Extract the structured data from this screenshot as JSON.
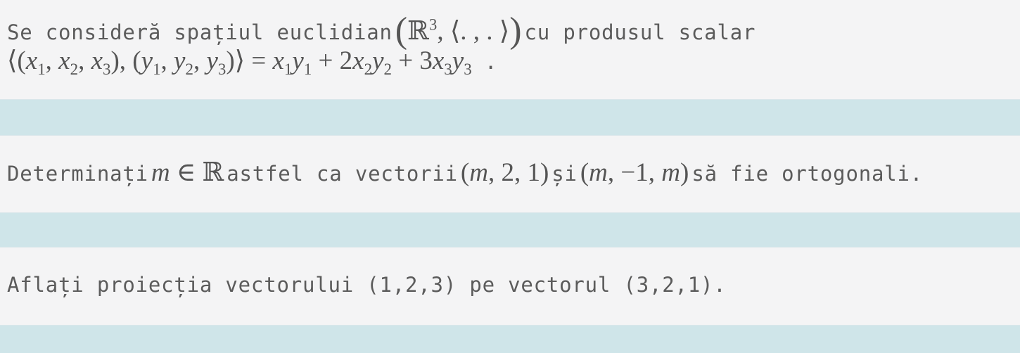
{
  "problem1": {
    "intro": "Se consideră spațiul euclidian",
    "space_open": "(",
    "space_R": "ℝ",
    "space_exp": "3",
    "space_rest": ", ⟨. , . ⟩",
    "space_close": ")",
    "tail": "cu produsul scalar",
    "eq": {
      "lhs_open": "⟨(",
      "x1": "x",
      "s1": "1",
      "x2": "x",
      "s2": "2",
      "x3": "x",
      "s3": "3",
      "mid": "), (",
      "y1": "y",
      "t1": "1",
      "y2": "y",
      "t2": "2",
      "y3": "y",
      "t3": "3",
      "lhs_close": ")⟩ = ",
      "r1x": "x",
      "r1s": "1",
      "r1y": "y",
      "r1t": "1",
      "plus1": " + 2",
      "r2x": "x",
      "r2s": "2",
      "r2y": "y",
      "r2t": "2",
      "plus2": " + 3",
      "r3x": "x",
      "r3s": "3",
      "r3y": "y",
      "r3t": "3",
      "period": " ."
    }
  },
  "problem2": {
    "prefix": "Determinați",
    "m": "m",
    "in_R": " ∈ ℝ",
    "middle": "astfel ca vectorii",
    "v1_open": "(",
    "v1_m": "m",
    "v1_rest": ", 2, 1)",
    "and": "și",
    "v2_open": "(",
    "v2_m": "m",
    "v2_mid": ", −1, ",
    "v2_m2": "m",
    "v2_close": ")",
    "suffix": "să fie ortogonali."
  },
  "problem3": {
    "text": "Aflați proiecția vectorului (1,2,3) pe vectorul (3,2,1)."
  }
}
